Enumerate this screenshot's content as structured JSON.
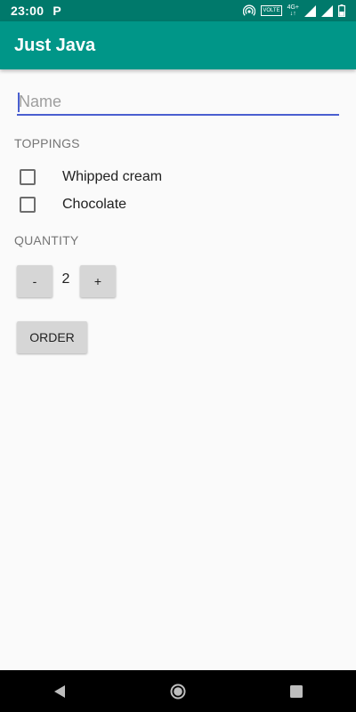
{
  "status_bar": {
    "time": "23:00",
    "notification_letter": "P",
    "volte_label": "VOLTE",
    "network_label": "4G+"
  },
  "app_bar": {
    "title": "Just Java"
  },
  "form": {
    "name_placeholder": "Name",
    "name_value": "",
    "toppings_label": "TOPPINGS",
    "toppings": [
      {
        "label": "Whipped cream",
        "checked": false
      },
      {
        "label": "Chocolate",
        "checked": false
      }
    ],
    "quantity_label": "QUANTITY",
    "decrement_label": "-",
    "quantity": "2",
    "increment_label": "+",
    "order_label": "ORDER"
  },
  "colors": {
    "status_bar": "#00796b",
    "app_bar": "#009688",
    "accent": "#4a5fd0",
    "button": "#d6d6d6"
  },
  "nav_bar": {
    "icons": [
      "back-icon",
      "home-icon",
      "recents-icon"
    ]
  }
}
